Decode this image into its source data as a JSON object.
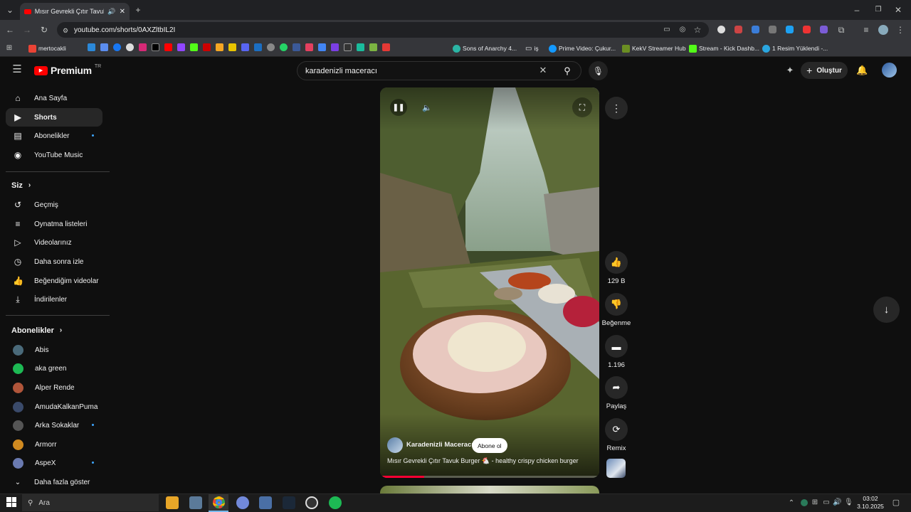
{
  "browser": {
    "tab_title": "Mısır Gevrekli Çıtır Tavuk Bu",
    "url": "youtube.com/shorts/0AXZltbIL2I",
    "bookmarks": [
      "mertocakli",
      "Sons of Anarchy 4...",
      "iş",
      "Prime Video: Çukur...",
      "KekV Streamer Hub",
      "Stream - Kick Dashb...",
      "1 Resim Yüklendi -..."
    ]
  },
  "header": {
    "logo_text": "Premium",
    "region": "TR",
    "search_value": "karadenizli maceracı",
    "create_label": "Oluştur"
  },
  "sidebar": {
    "main": [
      {
        "label": "Ana Sayfa",
        "icon": "home-icon"
      },
      {
        "label": "Shorts",
        "icon": "shorts-icon"
      },
      {
        "label": "Abonelikler",
        "icon": "subscriptions-icon"
      },
      {
        "label": "YouTube Music",
        "icon": "music-icon"
      }
    ],
    "you_title": "Siz",
    "you": [
      {
        "label": "Geçmiş",
        "icon": "history-icon"
      },
      {
        "label": "Oynatma listeleri",
        "icon": "playlist-icon"
      },
      {
        "label": "Videolarınız",
        "icon": "video-icon"
      },
      {
        "label": "Daha sonra izle",
        "icon": "clock-icon"
      },
      {
        "label": "Beğendiğim videolar",
        "icon": "thumb-up-icon"
      },
      {
        "label": "İndirilenler",
        "icon": "download-icon"
      }
    ],
    "subs_title": "Abonelikler",
    "subs": [
      {
        "label": "Abis",
        "color": "#4a6a7a"
      },
      {
        "label": "aka green",
        "color": "#1db954"
      },
      {
        "label": "Alper Rende",
        "color": "#b0553a"
      },
      {
        "label": "AmudaKalkanPuma",
        "color": "#3a4a6a"
      },
      {
        "label": "Arka Sokaklar",
        "color": "#555555"
      },
      {
        "label": "Armorr",
        "color": "#d08a20"
      },
      {
        "label": "AspeX",
        "color": "#6a7ab0"
      }
    ],
    "show_more": "Daha fazla göster"
  },
  "short": {
    "channel": "Karadenizli Maceracı",
    "subscribe": "Abone ol",
    "title": "Mısır Gevrekli Çıtır Tavuk Burger 🐔 - healthy crispy chicken burger",
    "progress": 0.2
  },
  "actions": {
    "likes": "129 B",
    "dislike": "Beğenme",
    "comments": "1.196",
    "share": "Paylaş",
    "remix": "Remix"
  },
  "taskbar": {
    "search_placeholder": "Ara",
    "time": "03:02",
    "date": "3.10.2025"
  }
}
